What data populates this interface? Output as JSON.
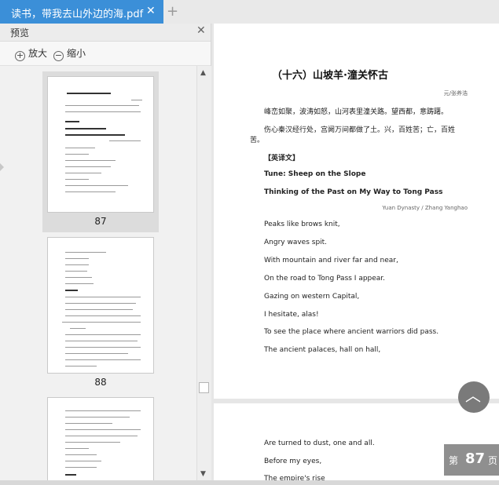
{
  "tab": {
    "title": "读书，带我去山外边的海.pdf",
    "close": "✕",
    "add": "+"
  },
  "sidebar": {
    "title": "预览",
    "close": "✕",
    "zoom_in": "放大",
    "zoom_out": "缩小",
    "pages": [
      {
        "num": "87"
      },
      {
        "num": "88"
      }
    ]
  },
  "document": {
    "title": "（十六）山坡羊·潼关怀古",
    "author": "元/张养浩",
    "lines": [
      "峰峦如聚，波涛如怒，山河表里潼关路。望西都，意踌躇。",
      "伤心秦汉经行处，宫阙万间都做了土。兴，百姓苦；亡，百姓",
      "苦。"
    ],
    "section": "【英译文】",
    "en_title1": "Tune: Sheep on the Slope",
    "en_title2": "Thinking of the Past on My Way to Tong Pass",
    "credit": "Yuan Dynasty / Zhang Yanghao",
    "poem": [
      "Peaks like brows knit,",
      "Angry waves spit.",
      "With mountain and river far and near,",
      "On the road to Tong Pass I appear.",
      "Gazing on western Capital,",
      "I hesitate, alas!",
      "To see the place where ancient warriors did pass.",
      "The ancient palaces, hall on hall,"
    ],
    "poem2": [
      "Are turned to dust, one and all.",
      "Before my eyes,",
      "The empire's rise"
    ]
  },
  "page_indicator": {
    "prefix": "第",
    "number": "87",
    "suffix": "页"
  }
}
